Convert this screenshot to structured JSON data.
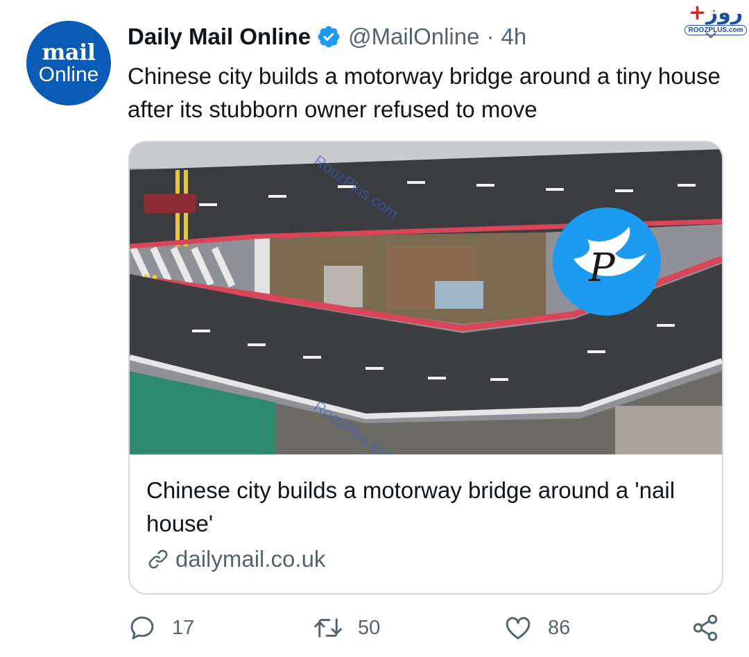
{
  "theme": {
    "accent": "#1d9bf0",
    "text": "#0f1419",
    "muted": "#536471",
    "border": "#cfd9de"
  },
  "watermark": {
    "logo_text": "روز",
    "url": "ROOZPLUS.com",
    "overlay_text": "RoozPlus.com"
  },
  "tweet": {
    "avatar": {
      "line1": "mail",
      "line2": "Online"
    },
    "display_name": "Daily Mail Online",
    "verified": true,
    "handle": "@MailOnline",
    "separator": "·",
    "time": "4h",
    "text": "Chinese city builds a motorway bridge around a tiny house after its stubborn owner refused to move"
  },
  "card": {
    "image_alt": "Aerial view of a motorway bridge built around a small house",
    "title": "Chinese city builds a motorway bridge around a 'nail house'",
    "domain": "dailymail.co.uk"
  },
  "actions": {
    "reply_count": "17",
    "retweet_count": "50",
    "like_count": "86"
  }
}
